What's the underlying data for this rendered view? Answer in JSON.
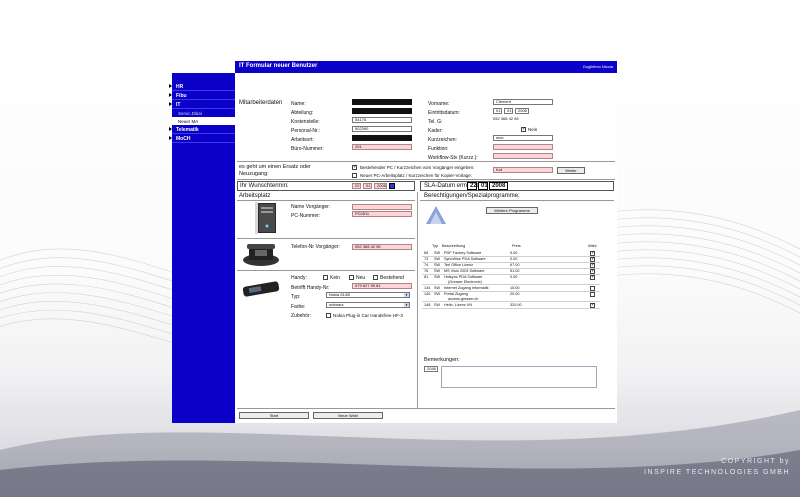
{
  "topbar": {
    "title": "IT Formular neuer Benutzer",
    "user": "Guglielmo Nicola"
  },
  "sidebar": {
    "items": [
      {
        "label": "HR"
      },
      {
        "label": "Fibu"
      },
      {
        "label": "IT"
      },
      {
        "label": "Telematik"
      },
      {
        "label": "MoCH"
      }
    ],
    "sub_items": [
      {
        "label": "Servic.Ditial"
      },
      {
        "label": "Neuer MA"
      }
    ]
  },
  "mitarbeiter": {
    "section_label": "Mitarbeiterdaten",
    "fields": [
      {
        "label": "Name:",
        "value": ""
      },
      {
        "label": "Abteilung:",
        "value": ""
      },
      {
        "label": "Kostenstelle:",
        "value": "54176"
      },
      {
        "label": "Personal-Nr.:",
        "value": "502390"
      },
      {
        "label": "Arbeitsort:",
        "value": ""
      },
      {
        "label": "Büro-Nummer:",
        "value": "201"
      }
    ],
    "right_fields": [
      {
        "label": "Vorname:",
        "value": "Clément"
      },
      {
        "label": "Eintrittsdatum:",
        "value": ""
      },
      {
        "label": "Tel. G:",
        "value": "052 368 42 96"
      },
      {
        "label": "Kader:",
        "value": "Nein"
      },
      {
        "label": "Kurzzeichen:",
        "value": "mec"
      },
      {
        "label": "Funktion:",
        "value": ""
      },
      {
        "label": "Workflow-Stv (Kurzz.):",
        "value": ""
      }
    ],
    "entry_date": {
      "day": "01",
      "month": "01",
      "year": "2008"
    }
  },
  "ersatz": {
    "question": "es geht um einen Ersatz oder Neuzugang:",
    "option1": "Bestehender PC / Kurzzeichen vom Vorgänger eingeben:",
    "option1_value": "Kof",
    "option2": "Neuer PC-Arbeitsplatz / Kurzzeichen für Kopier-Vorlage:",
    "weiter_label": "Weiter"
  },
  "wunschtermin": {
    "label": "Ihr Wunschtermin:",
    "day": "22",
    "month": "01",
    "year": "2008"
  },
  "sla": {
    "label": "SLA-Datum ermittelt:",
    "day": "22",
    "month": "01",
    "year": "2008"
  },
  "arbeitsplatz": {
    "title": "Arbeitsplatz",
    "name_vorgaenger_label": "Name Vorgänger:",
    "name_vorgaenger_value": "",
    "pc_nummer_label": "PC-Nummer:",
    "pc_nummer_value": "PC0511",
    "telefon_label": "Telefon-Nr Vorgänger:",
    "telefon_value": "052 368 42 96",
    "handy_label": "Handy:",
    "handy_options": [
      "Kein",
      "Neu",
      "Bestehend"
    ],
    "betrifft_label": "Betrifft Handy-Nr:",
    "betrifft_value": "079 627 99 81",
    "typ_label": "Typ:",
    "typ_value": "Nokia 6140i",
    "farbe_label": "Farbe:",
    "farbe_value": "schwarz",
    "zubehoer_label": "Zubehör:",
    "zubehoer_value": "Nokia Plug-in Car Handsfree HF-3"
  },
  "berechtigungen": {
    "title": "Berechtigungen/Spezialprogramme:",
    "weitere_button": "Weitere Programme",
    "columns": {
      "typ": "Typ",
      "beschreibung": "Beschreibung",
      "preis": "Preis",
      "wahl": "Wahl"
    },
    "rows": [
      {
        "nr": "65",
        "typ": "SW",
        "desc": "PDF Factory Software",
        "preis": "9.00"
      },
      {
        "nr": "73",
        "typ": "SW",
        "desc": "SyncWise PDA Software",
        "preis": "0.00"
      },
      {
        "nr": "74",
        "typ": "SW",
        "desc": "Teri Office Lizenz",
        "preis": "67.00"
      },
      {
        "nr": "76",
        "typ": "SW",
        "desc": "MS Visio 2003 Software",
        "preis": "51.00"
      },
      {
        "nr": "81",
        "typ": "SW",
        "desc": "Hotsync PDA Software",
        "desc2": "(Gresser Electronic)",
        "preis": "0.00"
      },
      {
        "nr": "134",
        "typ": "SW",
        "desc": "Internet Zugang Informatik",
        "preis": "15.00"
      },
      {
        "nr": "140",
        "typ": "SW",
        "desc": "Portal Zugang",
        "desc2": "access.gresser.ch",
        "preis": "20.00"
      },
      {
        "nr": "148",
        "typ": "SW",
        "desc": "Helio. Lizenz VN",
        "preis": "320.00"
      }
    ]
  },
  "bemerkungen": {
    "label": "Bemerkungen:",
    "count": "2046"
  },
  "footer": {
    "start_label": "Start",
    "neue_wahl_label": "Neue Wahl"
  },
  "copyright": {
    "line1": "COPYRIGHT by",
    "line2": "INSPIRE TECHNOLOGIES GMBH"
  }
}
